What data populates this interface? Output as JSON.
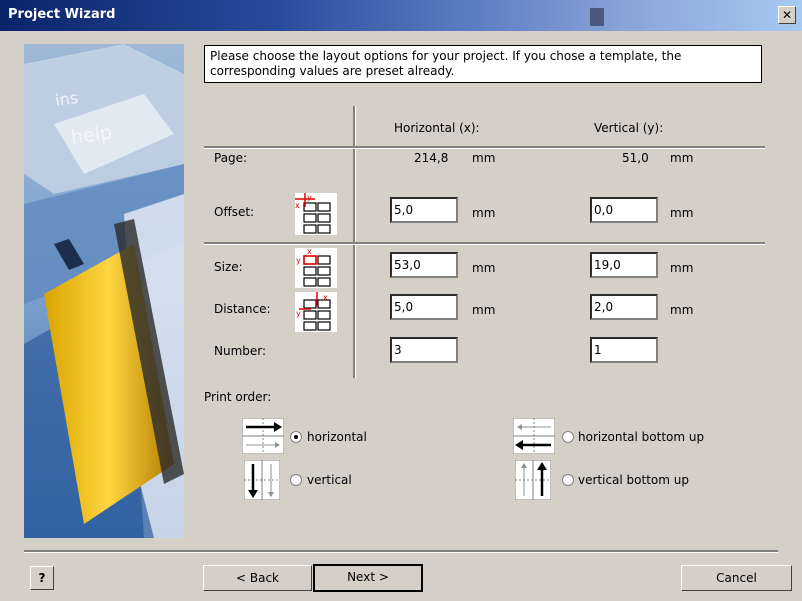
{
  "window": {
    "title": "Project Wizard",
    "close_glyph": "✕"
  },
  "side_image": {
    "words": [
      "ins",
      "help"
    ]
  },
  "intro_text": "Please choose the layout options for your project. If you chose a template, the corresponding values are preset already.",
  "columns": {
    "horizontal": "Horizontal (x):",
    "vertical": "Vertical (y):"
  },
  "rows": {
    "page": {
      "label": "Page:",
      "x": "214,8",
      "y": "51,0",
      "unit": "mm"
    },
    "offset": {
      "label": "Offset:",
      "x": "5,0",
      "y": "0,0",
      "unit": "mm"
    },
    "size": {
      "label": "Size:",
      "x": "53,0",
      "y": "19,0",
      "unit": "mm"
    },
    "distance": {
      "label": "Distance:",
      "x": "5,0",
      "y": "2,0",
      "unit": "mm"
    },
    "number": {
      "label": "Number:",
      "x": "3",
      "y": "1"
    }
  },
  "print_order": {
    "label": "Print order:",
    "options": {
      "horizontal": {
        "label": "horizontal",
        "checked": true
      },
      "vertical": {
        "label": "vertical",
        "checked": false
      },
      "horizontal_bottom_up": {
        "label": "horizontal bottom up",
        "checked": false
      },
      "vertical_bottom_up": {
        "label": "vertical bottom up",
        "checked": false
      }
    }
  },
  "buttons": {
    "help": "?",
    "back": "< Back",
    "next": "Next >",
    "cancel": "Cancel"
  },
  "colors": {
    "title_start": "#0a246a",
    "title_end": "#a6caf0",
    "dialog_bg": "#d4d0c8",
    "marker_red": "#e00000"
  }
}
